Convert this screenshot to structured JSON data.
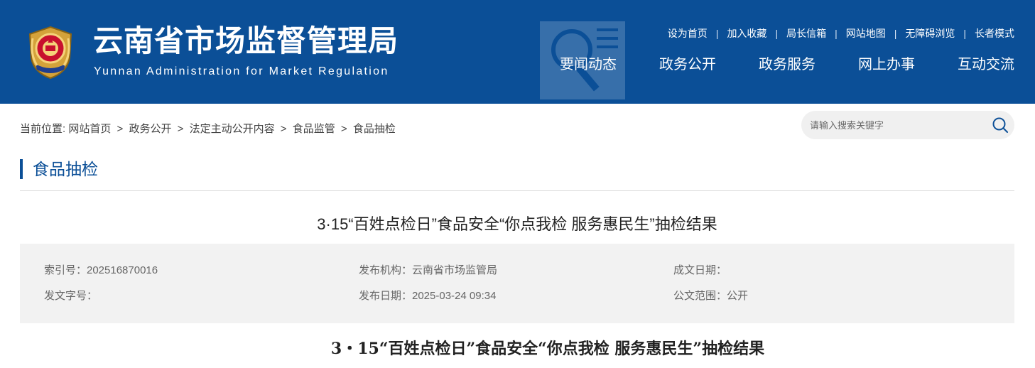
{
  "header": {
    "title": "云南省市场监督管理局",
    "subtitle": "Yunnan Administration for Market Regulation",
    "top_links": [
      "设为首页",
      "加入收藏",
      "局长信箱",
      "网站地图",
      "无障碍浏览",
      "长者模式"
    ],
    "separator": "|",
    "nav": [
      "要闻动态",
      "政务公开",
      "政务服务",
      "网上办事",
      "互动交流"
    ],
    "color": "#0b4f97"
  },
  "breadcrumb": {
    "prefix": "当前位置:",
    "items": [
      "网站首页",
      "政务公开",
      "法定主动公开内容",
      "食品监管",
      "食品抽检"
    ],
    "separator": ">"
  },
  "search": {
    "placeholder": "请输入搜索关键字",
    "icon": "search-icon"
  },
  "section": {
    "title": "食品抽检"
  },
  "article": {
    "title": "3·15“百姓点检日”食品安全“你点我检 服务惠民生”抽检结果",
    "meta": {
      "index_no": "索引号：202516870016",
      "publisher": "发布机构：云南省市场监管局",
      "created_date": "成文日期：",
      "doc_no": "发文字号：",
      "publish_date": "发布日期：2025-03-24 09:34",
      "scope": "公文范围：公开"
    },
    "body_title": "3・15“百姓点检日”食品安全“你点我检 服务惠民生”抽检结果"
  }
}
